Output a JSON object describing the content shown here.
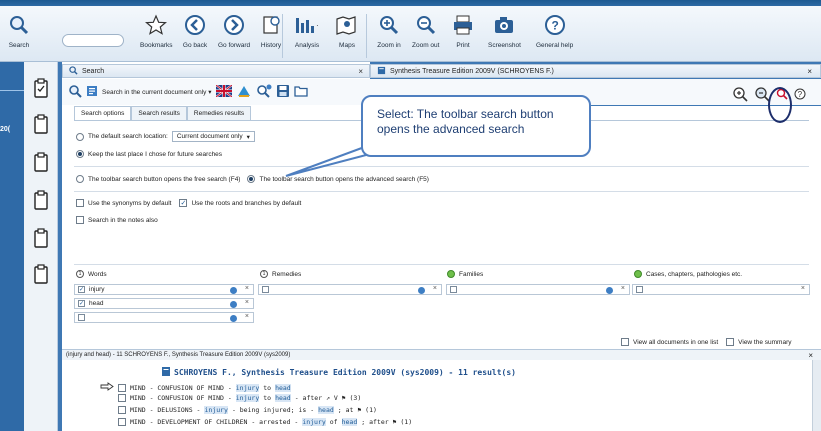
{
  "ribbon": {
    "search_label": "Search",
    "buttons": [
      {
        "label": "Bookmarks",
        "icon": "star-icon"
      },
      {
        "label": "Go back",
        "icon": "arrow-left-icon"
      },
      {
        "label": "Go forward",
        "icon": "arrow-right-icon"
      },
      {
        "label": "History",
        "icon": "history-icon"
      },
      {
        "label": "Analysis",
        "icon": "analysis-icon"
      },
      {
        "label": "Maps",
        "icon": "maps-icon"
      },
      {
        "label": "Zoom in",
        "icon": "zoom-in-icon"
      },
      {
        "label": "Zoom out",
        "icon": "zoom-out-icon"
      },
      {
        "label": "Print",
        "icon": "print-icon"
      },
      {
        "label": "Screenshot",
        "icon": "camera-icon"
      },
      {
        "label": "General help",
        "icon": "help-icon"
      }
    ]
  },
  "left_strip": {
    "number": "20("
  },
  "search_panel": {
    "tab_title": "Search",
    "toolbar_dropdown": "Search in the current document only"
  },
  "synthesis_tab": {
    "title": "Synthesis Treasure Edition 2009V (SCHROYENS F.)"
  },
  "option_tabs": [
    "Search options",
    "Search results",
    "Remedies results"
  ],
  "options": {
    "default_location_label": "The default search location:",
    "default_location_value": "Current document only",
    "keep_last_place": "Keep the last place I chose for future searches",
    "free_search": "The toolbar search button opens the free search (F4)",
    "advanced_search": "The toolbar search button opens the advanced search (F5)",
    "use_synonyms": "Use the synonyms by default",
    "use_roots": "Use the roots and branches by default",
    "search_notes": "Search in the notes also"
  },
  "columns": {
    "words": "Words",
    "remedies": "Remedies",
    "families": "Families",
    "cases": "Cases, chapters, pathologies etc."
  },
  "terms": [
    "injury",
    "head"
  ],
  "view_all_docs": "View all documents in one list",
  "view_summary": "View the summary",
  "results_header": "(injury and head) - 11  SCHROYENS F., Synthesis Treasure Edition 2009V (sys2009)",
  "results_title": "SCHROYENS F., Synthesis Treasure Edition 2009V (sys2009) - 11 result(s)",
  "results": [
    {
      "pre": "MIND - CONFUSION OF MIND - ",
      "w1": "injury",
      "mid": " to ",
      "w2": "head",
      "post": ""
    },
    {
      "pre": "MIND - CONFUSION OF MIND - ",
      "w1": "injury",
      "mid": " to ",
      "w2": "head",
      "post": " - after ↗ V ⚑ (3)"
    },
    {
      "pre": "MIND - DELUSIONS - ",
      "w1": "injury",
      "mid": " - being injured; is - ",
      "w2": "head",
      "post": "; at ⚑ (1)"
    },
    {
      "pre": "MIND - DEVELOPMENT OF CHILDREN - arrested - ",
      "w1": "injury",
      "mid": " of ",
      "w2": "head",
      "post": "; after ⚑ (1)"
    }
  ],
  "callout": {
    "text": "Select: The toolbar search button opens the advanced search"
  },
  "colors": {
    "frame": "#3f78b4",
    "accent": "#1f4f8b",
    "highlight": "#d8e6f5"
  }
}
